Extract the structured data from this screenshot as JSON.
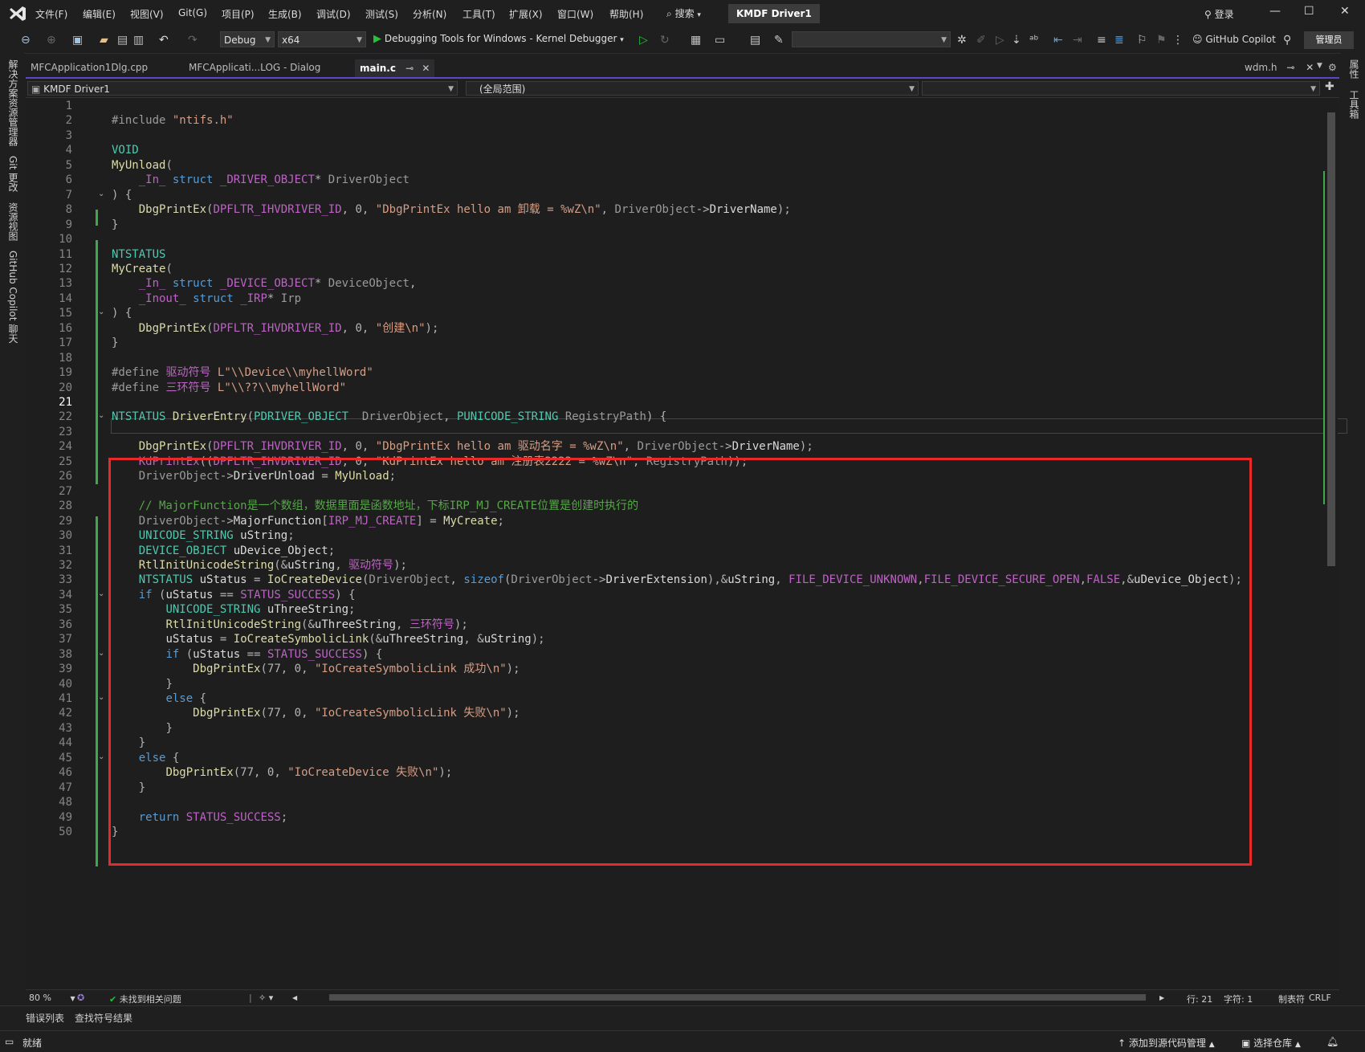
{
  "titlebar": {
    "menus": [
      "文件(F)",
      "编辑(E)",
      "视图(V)",
      "Git(G)",
      "项目(P)",
      "生成(B)",
      "调试(D)",
      "测试(S)",
      "分析(N)",
      "工具(T)",
      "扩展(X)",
      "窗口(W)",
      "帮助(H)"
    ],
    "search_label": "搜索",
    "project_name": "KMDF Driver1",
    "login_label": "登录"
  },
  "toolbar": {
    "config": "Debug",
    "platform": "x64",
    "run_target": "Debugging Tools for Windows - Kernel Debugger",
    "copilot_label": "GitHub Copilot",
    "admin_label": "管理员"
  },
  "left_tabs": [
    "解决方案资源管理器",
    "Git 更改",
    "资源视图",
    "GitHub Copilot 聊天"
  ],
  "right_tabs": [
    "属性",
    "工具箱"
  ],
  "doc_tabs": [
    "MFCApplication1Dlg.cpp",
    "MFCApplicati...LOG - Dialog",
    "main.c"
  ],
  "right_doc_tab": "wdm.h",
  "navbar": {
    "project": "KMDF Driver1",
    "scope": "(全局范围)"
  },
  "editor": {
    "current_line": 21,
    "lines": [
      "",
      "#include \"ntifs.h\"",
      "",
      "VOID",
      "MyUnload(",
      "    _In_ struct _DRIVER_OBJECT* DriverObject",
      ") {",
      "    DbgPrintEx(DPFLTR_IHVDRIVER_ID, 0, \"DbgPrintEx hello am 卸载 = %wZ\\n\", DriverObject->DriverName);",
      "}",
      "",
      "NTSTATUS",
      "MyCreate(",
      "    _In_ struct _DEVICE_OBJECT* DeviceObject,",
      "    _Inout_ struct _IRP* Irp",
      ") {",
      "    DbgPrintEx(DPFLTR_IHVDRIVER_ID, 0, \"创建\\n\");",
      "}",
      "",
      "#define 驱动符号 L\"\\\\Device\\\\myhellWord\"",
      "#define 三环符号 L\"\\\\??\\\\myhellWord\"",
      "",
      "NTSTATUS DriverEntry(PDRIVER_OBJECT  DriverObject, PUNICODE_STRING RegistryPath) {",
      "",
      "    DbgPrintEx(DPFLTR_IHVDRIVER_ID, 0, \"DbgPrintEx hello am 驱动名字 = %wZ\\n\", DriverObject->DriverName);",
      "    KdPrintEx((DPFLTR_IHVDRIVER_ID, 0, \"KdPrintEx hello am 注册表2222 = %wZ\\n\", RegistryPath));",
      "    DriverObject->DriverUnload = MyUnload;",
      "",
      "    // MajorFunction是一个数组，数据里面是函数地址，下标IRP_MJ_CREATE位置是创建时执行的",
      "    DriverObject->MajorFunction[IRP_MJ_CREATE] = MyCreate;",
      "    UNICODE_STRING uString;",
      "    DEVICE_OBJECT uDevice_Object;",
      "    RtlInitUnicodeString(&uString, 驱动符号);",
      "    NTSTATUS uStatus = IoCreateDevice(DriverObject, sizeof(DriverObject->DriverExtension),&uString, FILE_DEVICE_UNKNOWN,FILE_DEVICE_SECURE_OPEN,FALSE,&uDevice_Object);",
      "    if (uStatus == STATUS_SUCCESS) {",
      "        UNICODE_STRING uThreeString;",
      "        RtlInitUnicodeString(&uThreeString, 三环符号);",
      "        uStatus = IoCreateSymbolicLink(&uThreeString, &uString);",
      "        if (uStatus == STATUS_SUCCESS) {",
      "            DbgPrintEx(77, 0, \"IoCreateSymbolicLink 成功\\n\");",
      "        }",
      "        else {",
      "            DbgPrintEx(77, 0, \"IoCreateSymbolicLink 失败\\n\");",
      "        }",
      "    }",
      "    else {",
      "        DbgPrintEx(77, 0, \"IoCreateDevice 失败\\n\");",
      "    }",
      "",
      "    return STATUS_SUCCESS;",
      "}"
    ]
  },
  "editor_status": {
    "zoom": "80 %",
    "issues": "未找到相关问题",
    "line": "行: 21",
    "char": "字符: 1",
    "indent": "制表符",
    "eol": "CRLF"
  },
  "bottom_tabs": [
    "错误列表",
    "查找符号结果"
  ],
  "statusbar": {
    "ready": "就绪",
    "add_source": "添加到源代码管理",
    "select_repo": "选择仓库"
  }
}
